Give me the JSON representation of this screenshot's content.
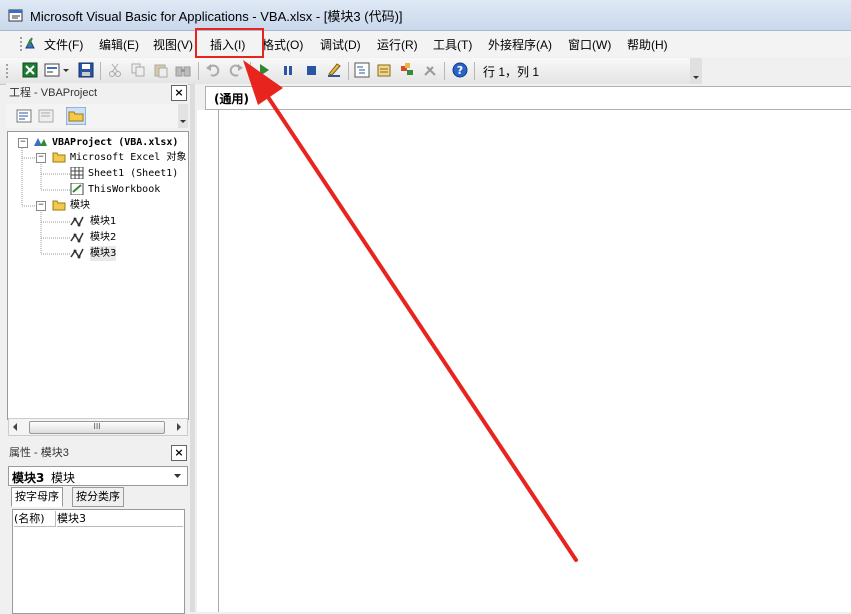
{
  "window": {
    "title": "Microsoft Visual Basic for Applications - VBA.xlsx - [模块3 (代码)]"
  },
  "menu": {
    "items": [
      "文件(F)",
      "编辑(E)",
      "视图(V)",
      "插入(I)",
      "格式(O)",
      "调试(D)",
      "运行(R)",
      "工具(T)",
      "外接程序(A)",
      "窗口(W)",
      "帮助(H)"
    ],
    "highlighted_index": 3
  },
  "toolbar": {
    "position_readout": "行 1，列 1"
  },
  "project_panel": {
    "title": "工程 - VBAProject",
    "close_glyph": "×",
    "tree": {
      "root": "VBAProject (VBA.xlsx)",
      "excel_objects_folder": "Microsoft Excel 对象",
      "sheet1": "Sheet1 (Sheet1)",
      "thisworkbook": "ThisWorkbook",
      "modules_folder": "模块",
      "modules": [
        "模块1",
        "模块2",
        "模块3"
      ]
    },
    "scroll_thumb_grip": "III"
  },
  "properties_panel": {
    "title": "属性 - 模块3",
    "close_glyph": "×",
    "object_name": "模块3",
    "object_type": "模块",
    "tabs": [
      "按字母序",
      "按分类序"
    ],
    "active_tab": 0,
    "rows": [
      {
        "name": "(名称)",
        "value": "模块3"
      }
    ]
  },
  "code_window": {
    "object_combo": "(通用)"
  },
  "annotation": {
    "color": "#e8241f"
  }
}
